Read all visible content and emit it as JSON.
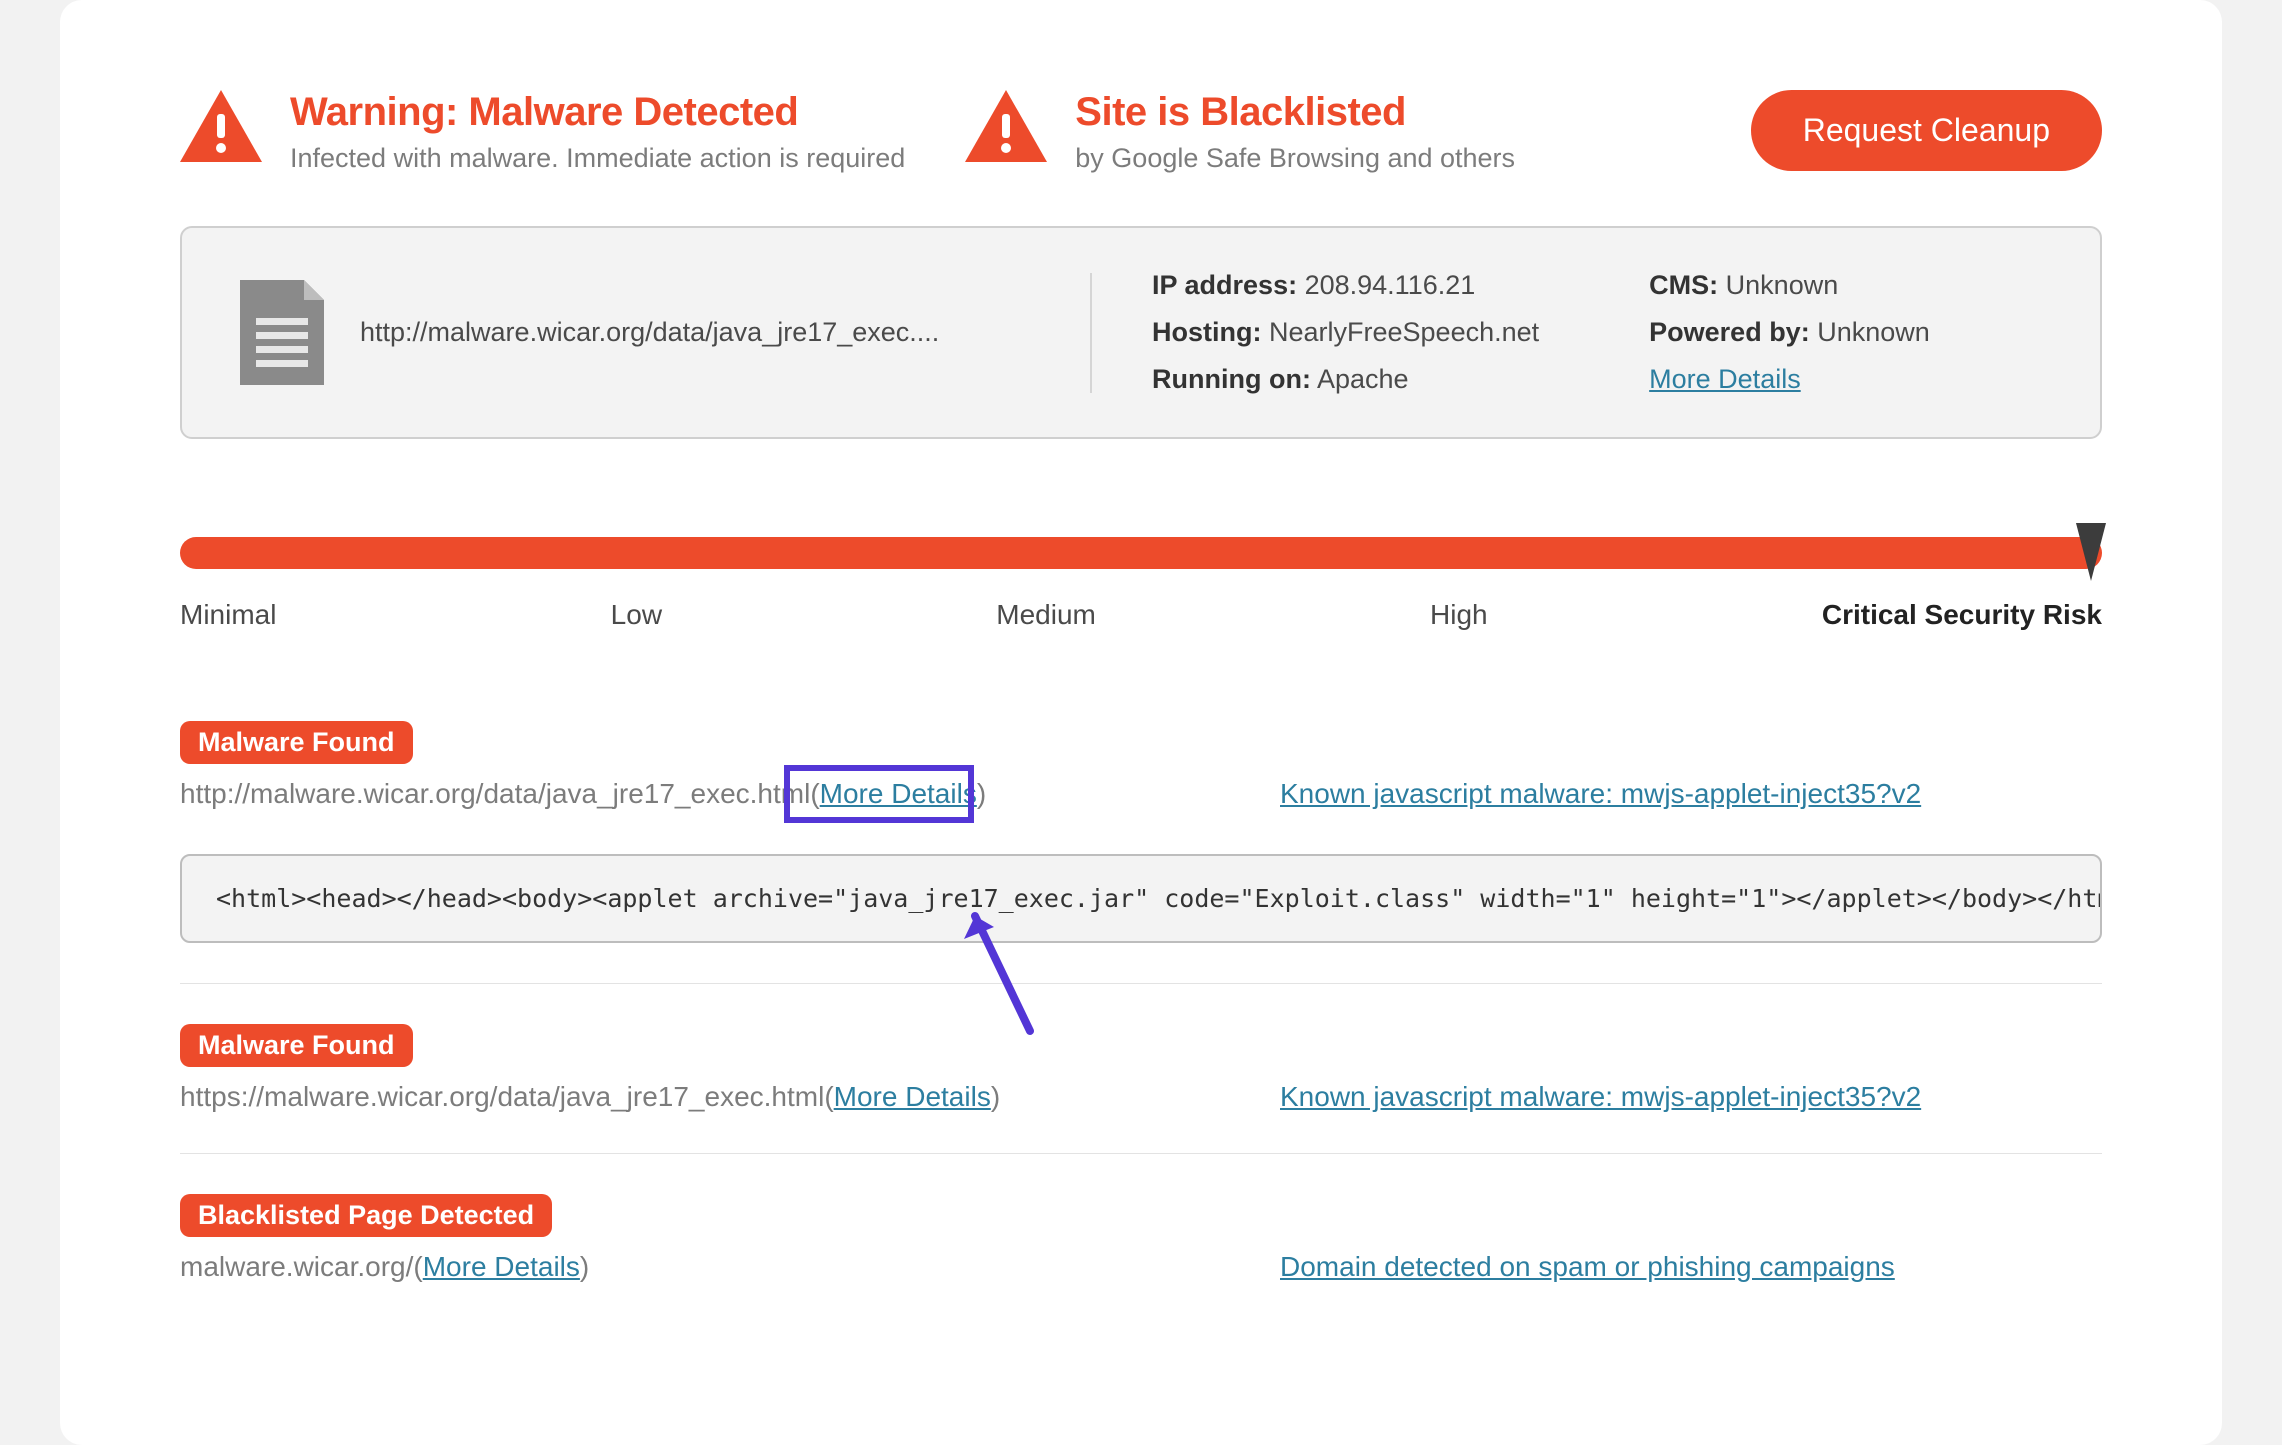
{
  "header": {
    "warning1": {
      "title": "Warning: Malware Detected",
      "sub": "Infected with malware. Immediate action is required"
    },
    "warning2": {
      "title": "Site is Blacklisted",
      "sub": "by Google Safe Browsing and others"
    },
    "cleanup_btn": "Request Cleanup"
  },
  "site": {
    "url": "http://malware.wicar.org/data/java_jre17_exec....",
    "col1": {
      "ip_label": "IP address:",
      "ip_value": "208.94.116.21",
      "host_label": "Hosting:",
      "host_value": "NearlyFreeSpeech.net",
      "run_label": "Running on:",
      "run_value": "Apache"
    },
    "col2": {
      "cms_label": "CMS:",
      "cms_value": "Unknown",
      "pby_label": "Powered by:",
      "pby_value": "Unknown",
      "more_details": "More Details"
    }
  },
  "risk": {
    "levels": {
      "minimal": "Minimal",
      "low": "Low",
      "medium": "Medium",
      "high": "High",
      "critical": "Critical Security Risk"
    }
  },
  "more_details_text": "More Details",
  "findings": [
    {
      "badge": "Malware Found",
      "target": "http://malware.wicar.org/data/java_jre17_exec.html",
      "threat": "Known javascript malware: mwjs-applet-inject35?v2",
      "code": "<html><head></head><body><applet archive=\"java_jre17_exec.jar\" code=\"Exploit.class\" width=\"1\" height=\"1\"></applet></body></html>",
      "highlighted": true
    },
    {
      "badge": "Malware Found",
      "target": "https://malware.wicar.org/data/java_jre17_exec.html",
      "threat": "Known javascript malware: mwjs-applet-inject35?v2"
    },
    {
      "badge": "Blacklisted Page Detected",
      "target": "malware.wicar.org/",
      "threat": "Domain detected on spam or phishing campaigns"
    }
  ]
}
